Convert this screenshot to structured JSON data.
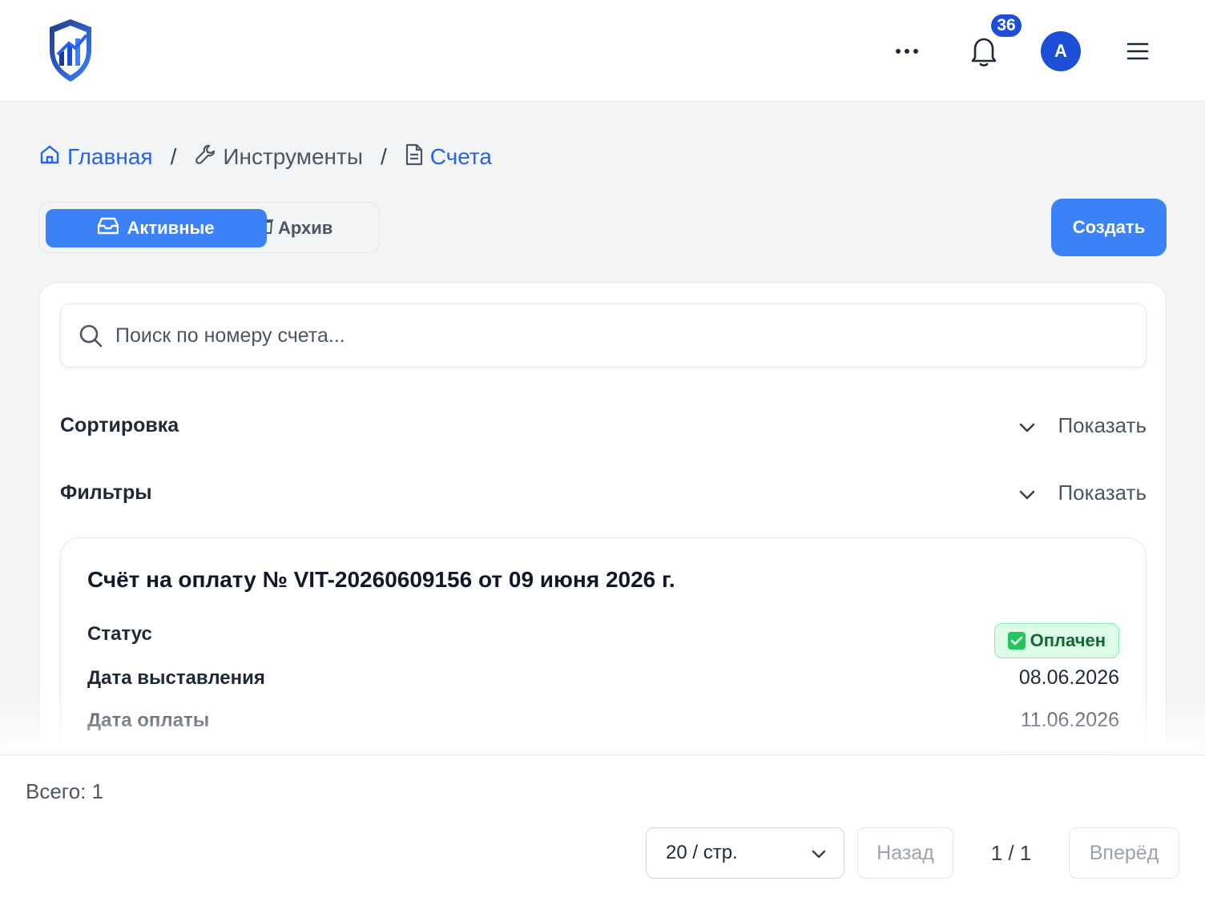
{
  "header": {
    "badge_count": "36",
    "avatar_initial": "A"
  },
  "breadcrumb": {
    "home": "Главная",
    "tools": "Инструменты",
    "current": "Счета"
  },
  "tabs": {
    "active": "Активные",
    "archive": "Архив"
  },
  "create_label": "Создать",
  "search": {
    "placeholder": "Поиск по номеру счета...",
    "value": ""
  },
  "sections": {
    "sort_title": "Сортировка",
    "sort_toggle": "Показать",
    "filters_title": "Фильтры",
    "filters_toggle": "Показать"
  },
  "invoice": {
    "title": "Счёт на оплату № VIT-20260609156 от 09 июня 2026 г.",
    "status_label": "Статус",
    "status_value": "Оплачен",
    "issue_label": "Дата выставления",
    "issue_value": "08.06.2026",
    "paid_label": "Дата оплаты",
    "paid_value": "11.06.2026"
  },
  "footer": {
    "total": "Всего: 1",
    "per_page": "20 / стр.",
    "prev": "Назад",
    "page_info": "1 / 1",
    "next": "Вперёд"
  },
  "colors": {
    "accent": "#3b82f6",
    "brand_dark": "#1d4ed8",
    "status_bg": "#dcfce7",
    "status_text": "#166534"
  }
}
